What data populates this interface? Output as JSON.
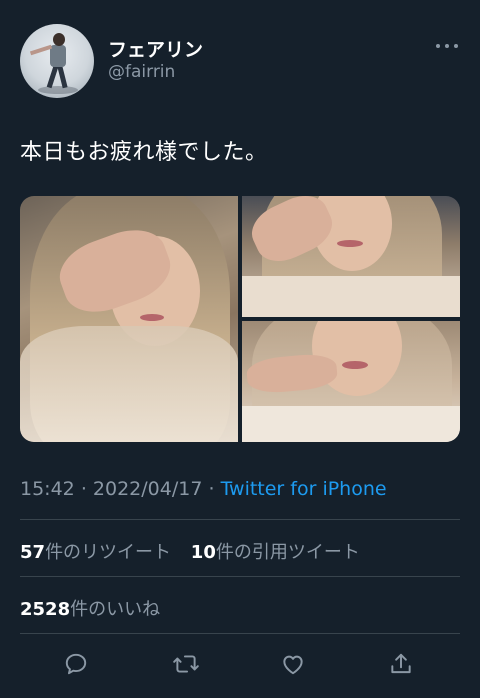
{
  "user": {
    "display_name": "フェアリン",
    "handle": "@fairrin",
    "avatar_icon": "avatar"
  },
  "tweet": {
    "text": "本日もお疲れ様でした。",
    "time": "15:42",
    "date": "2022/04/17",
    "separator": "·",
    "source": "Twitter for iPhone"
  },
  "stats": {
    "retweets_count": "57",
    "retweets_label": "件のリツイート",
    "quotes_count": "10",
    "quotes_label": "件の引用ツイート",
    "likes_count": "2528",
    "likes_label": "件のいいね"
  },
  "actions": [
    {
      "icon": "reply-icon"
    },
    {
      "icon": "retweet-icon"
    },
    {
      "icon": "like-icon"
    },
    {
      "icon": "share-icon"
    }
  ],
  "colors": {
    "background": "#15202b",
    "accent": "#1d9bf0",
    "secondary_text": "#8b98a5",
    "divider": "#38444d"
  }
}
